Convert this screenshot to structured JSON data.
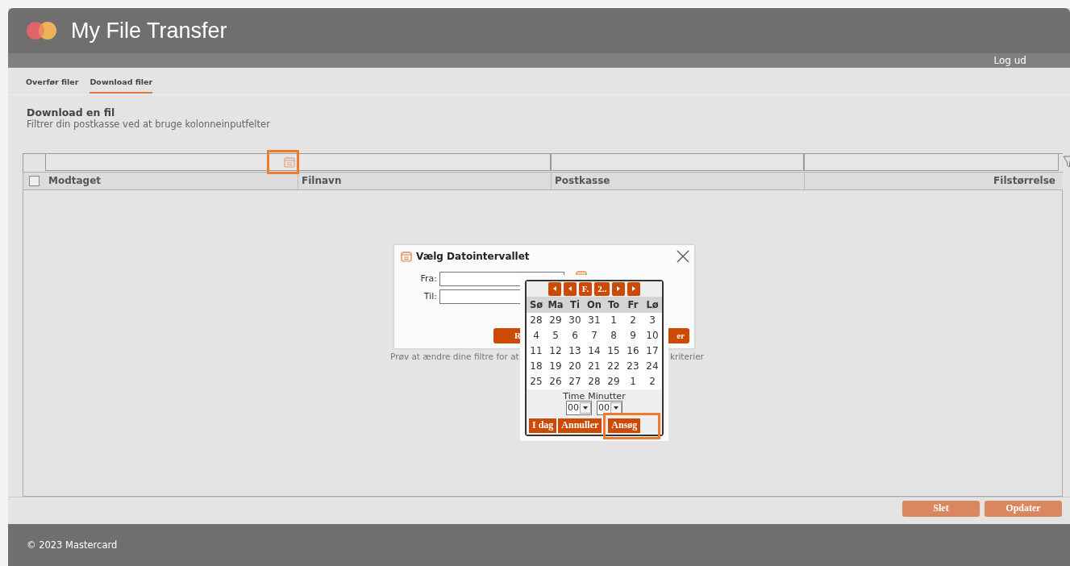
{
  "header": {
    "title": "My File Transfer",
    "logout": "Log ud"
  },
  "tabs": [
    {
      "label": "Overfør filer",
      "selected": false
    },
    {
      "label": "Download filer",
      "selected": true
    }
  ],
  "page": {
    "heading": "Download en fil",
    "subtitle": "Filtrer din postkasse ved at bruge kolonneinputfelter"
  },
  "table": {
    "select_all": {
      "checked": false
    },
    "columns": [
      {
        "label": "Modtaget",
        "highlighted": true
      },
      {
        "label": "Filnavn",
        "highlighted": false
      },
      {
        "label": "Postkasse",
        "highlighted": false
      },
      {
        "label": "Filstørrelse",
        "highlighted": false
      }
    ],
    "empty_message": [
      "Prøv at ændre dine filtre for at",
      "kriterier"
    ]
  },
  "date_dialog": {
    "title": "Vælg Datointervallet",
    "fields": [
      {
        "label": "Fra:"
      },
      {
        "label": "Til:"
      }
    ],
    "buttons": [
      "R",
      "er"
    ]
  },
  "calendar": {
    "nav": [
      "F.",
      "2.."
    ],
    "weekdays": [
      "Sø",
      "Ma",
      "Ti",
      "On",
      "To",
      "Fr",
      "Lø"
    ],
    "weeks": [
      [
        "28",
        "29",
        "30",
        "31",
        "1",
        "2",
        "3"
      ],
      [
        "4",
        "5",
        "6",
        "7",
        "8",
        "9",
        "10"
      ],
      [
        "11",
        "12",
        "13",
        "14",
        "15",
        "16",
        "17"
      ],
      [
        "18",
        "19",
        "20",
        "21",
        "22",
        "23",
        "24"
      ],
      [
        "25",
        "26",
        "27",
        "28",
        "29",
        "1",
        "2"
      ]
    ],
    "time": {
      "hour_label": "Time",
      "hour": "00",
      "minute_label": "Minutter",
      "minute": "00"
    },
    "buttons": [
      {
        "label": "I dag",
        "highlighted": false
      },
      {
        "label": "Annuller",
        "highlighted": false
      },
      {
        "label": "Ansøg",
        "highlighted": true
      }
    ]
  },
  "actions": [
    "Slet",
    "Opdater"
  ],
  "footer": "© 2023 Mastercard"
}
